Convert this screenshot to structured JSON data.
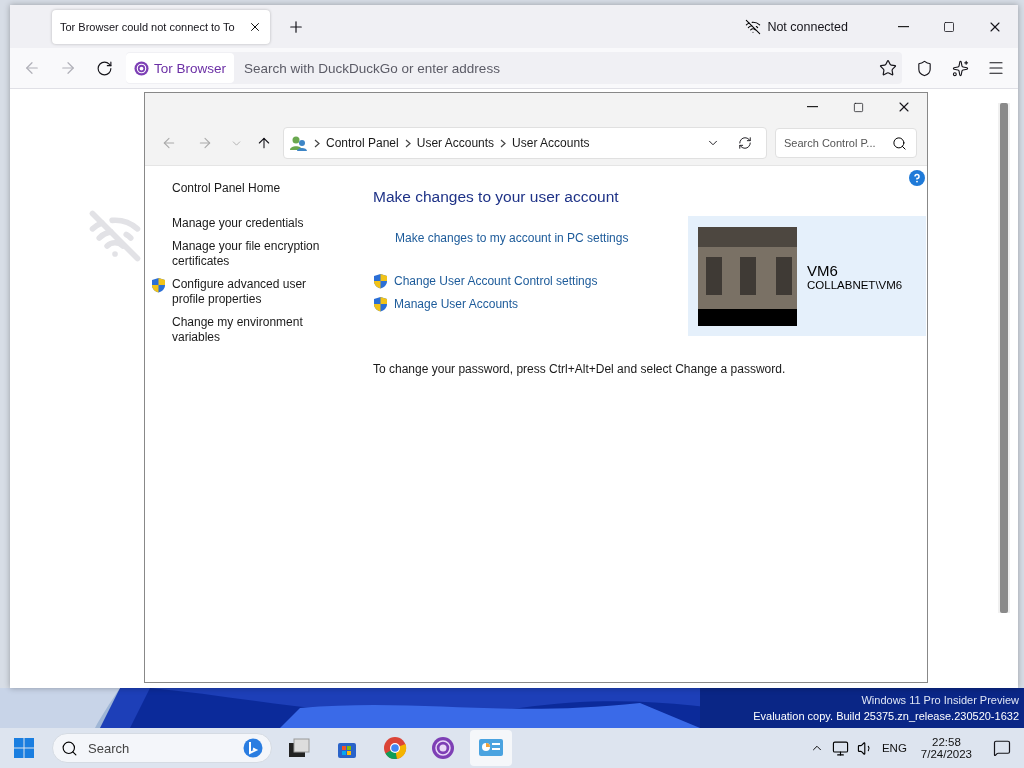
{
  "browser": {
    "tab": {
      "title": "Tor Browser could not connect to To",
      "selected": true
    },
    "status": "Not connected",
    "identity": "Tor Browser",
    "address": {
      "placeholder": "Search with DuckDuckGo or enter address"
    }
  },
  "control_panel": {
    "breadcrumb": [
      "Control Panel",
      "User Accounts",
      "User Accounts"
    ],
    "search": {
      "placeholder": "Search Control P..."
    },
    "sidebar": [
      {
        "label": "Control Panel Home",
        "kind": "link"
      },
      {
        "label": "Manage your credentials",
        "kind": "link"
      },
      {
        "label": "Manage your file encryption certificates",
        "kind": "link"
      },
      {
        "label": "Configure advanced user profile properties",
        "kind": "shield"
      },
      {
        "label": "Change my environment variables",
        "kind": "link"
      }
    ],
    "heading": "Make changes to your user account",
    "links": [
      {
        "label": "Make changes to my account in PC settings",
        "kind": "plain"
      },
      {
        "label": "Change User Account Control settings",
        "kind": "shield"
      },
      {
        "label": "Manage User Accounts",
        "kind": "shield"
      }
    ],
    "account": {
      "name": "VM6",
      "domain": "COLLABNET\\VM6"
    },
    "note": "To change your password, press Ctrl+Alt+Del and select Change a password."
  },
  "desktop": {
    "watermark": [
      "Windows 11 Pro Insider Preview",
      "Evaluation copy. Build 25375.zn_release.230520-1632"
    ]
  },
  "taskbar": {
    "search": {
      "placeholder": "Search"
    },
    "apps": [
      {
        "kind": "taskview",
        "selected": false
      },
      {
        "kind": "store",
        "selected": false
      },
      {
        "kind": "chrome",
        "selected": false
      },
      {
        "kind": "tor",
        "selected": false
      },
      {
        "kind": "controlpanel",
        "selected": true
      }
    ],
    "language": "ENG",
    "time": "22:58",
    "date": "7/24/2023"
  }
}
